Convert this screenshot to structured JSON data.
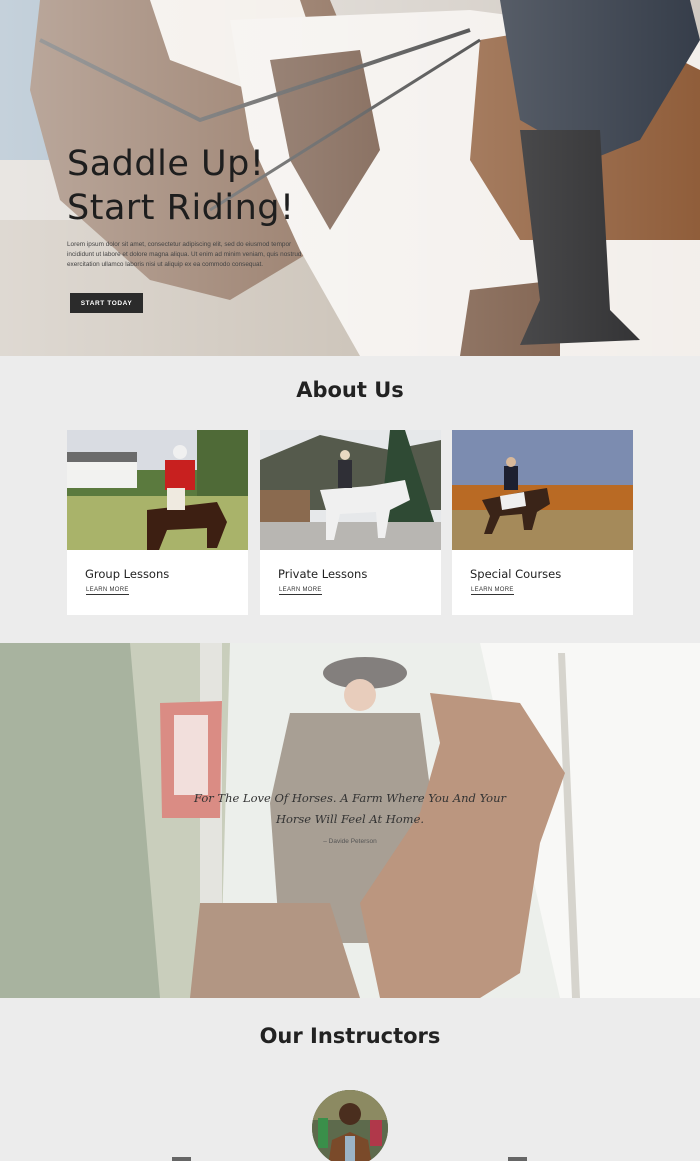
{
  "hero": {
    "title_line1": "Saddle Up!",
    "title_line2": "Start Riding!",
    "body": "Lorem ipsum dolor sit amet, consectetur adipiscing elit, sed do eiusmod tempor incididunt ut labore et dolore magna aliqua. Ut enim ad minim veniam, quis nostrud exercitation ullamco laboris nisi ut aliquip ex ea commodo consequat.",
    "button": "START TODAY"
  },
  "about": {
    "title": "About Us",
    "cards": [
      {
        "title": "Group Lessons",
        "link": "LEARN MORE"
      },
      {
        "title": "Private Lessons",
        "link": "LEARN MORE"
      },
      {
        "title": "Special Courses",
        "link": "LEARN MORE"
      }
    ]
  },
  "quote": {
    "text": "For The Love Of Horses. A Farm Where You And Your Horse Will Feel At Home.",
    "author": "– Davide Peterson"
  },
  "instructors": {
    "title": "Our Instructors"
  },
  "colors": {
    "background": "#ececec",
    "button": "#2b2b2b",
    "text": "#222222"
  }
}
